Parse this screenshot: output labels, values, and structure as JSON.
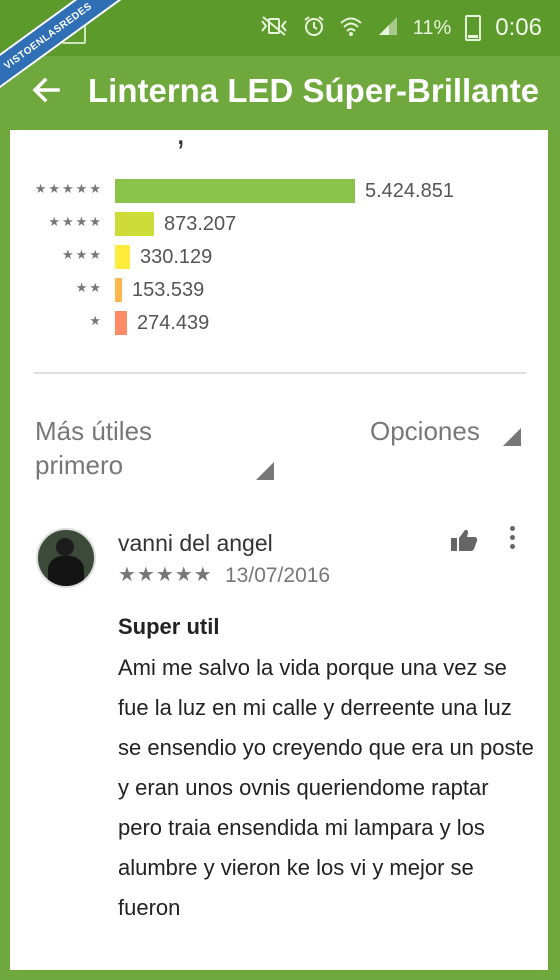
{
  "watermark": "VISTOENLASREDES",
  "status_bar": {
    "battery": "11%",
    "time": "0:06",
    "icons": [
      "mute-vibrate-icon",
      "alarm-icon",
      "wifi-icon",
      "signal-icon",
      "battery-icon"
    ]
  },
  "app_bar": {
    "title": "Linterna LED Súper-Brillante",
    "back_icon": "arrow-left-icon"
  },
  "ratings": [
    {
      "stars": "★★★★★",
      "stars_count": 5,
      "count": "5.424.851",
      "color": "#8bc34a"
    },
    {
      "stars": "★★★★",
      "stars_count": 4,
      "count": "873.207",
      "color": "#cddc39"
    },
    {
      "stars": "★★★",
      "stars_count": 3,
      "count": "330.129",
      "color": "#ffeb3b"
    },
    {
      "stars": "★★",
      "stars_count": 2,
      "count": "153.539",
      "color": "#ffb74d"
    },
    {
      "stars": "★",
      "stars_count": 1,
      "count": "274.439",
      "color": "#ff8a65"
    }
  ],
  "sort": {
    "label": "Más útiles primero",
    "options_label": "Opciones"
  },
  "review": {
    "author": "vanni del angel",
    "rating_stars": "★★★★★",
    "rating": 5,
    "date": "13/07/2016",
    "title": "Super util",
    "body": "Ami me salvo la vida porque una vez se fue la luz en mi calle y derreente una luz se ensendio yo creyendo que era un poste y eran unos ovnis queriendome raptar pero traia ensendida mi lampara y los alumbre y vieron ke los vi y mejor se fueron"
  }
}
